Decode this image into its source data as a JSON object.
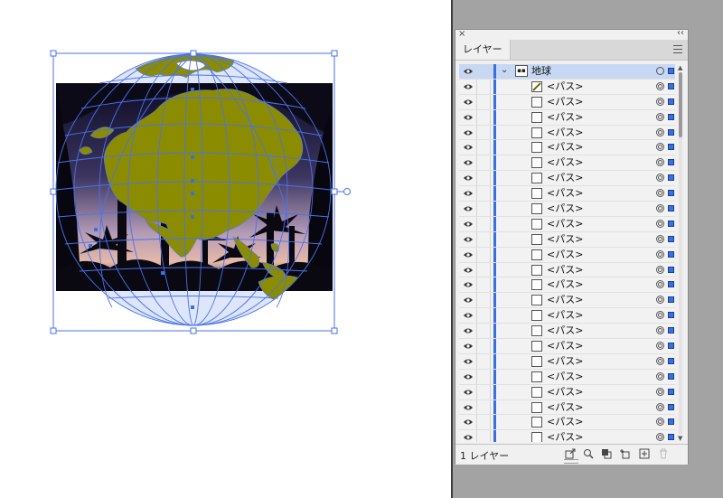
{
  "panel": {
    "close_glyph": "×",
    "collapse_glyph": "‹‹",
    "tab_label": "レイヤー",
    "menu_icon": "hamburger-menu-icon",
    "layer": {
      "name": "地球",
      "expanded": true,
      "selected": true
    },
    "sublayers": [
      {
        "name": "<パス>",
        "thumb": "diagonal"
      },
      {
        "name": "<パス>",
        "thumb": "blank"
      },
      {
        "name": "<パス>",
        "thumb": "blank"
      },
      {
        "name": "<パス>",
        "thumb": "blank"
      },
      {
        "name": "<パス>",
        "thumb": "blank"
      },
      {
        "name": "<パス>",
        "thumb": "blank"
      },
      {
        "name": "<パス>",
        "thumb": "blank"
      },
      {
        "name": "<パス>",
        "thumb": "blank"
      },
      {
        "name": "<パス>",
        "thumb": "blank"
      },
      {
        "name": "<パス>",
        "thumb": "blank"
      },
      {
        "name": "<パス>",
        "thumb": "blank"
      },
      {
        "name": "<パス>",
        "thumb": "blank"
      },
      {
        "name": "<パス>",
        "thumb": "blank"
      },
      {
        "name": "<パス>",
        "thumb": "blank"
      },
      {
        "name": "<パス>",
        "thumb": "blank"
      },
      {
        "name": "<パス>",
        "thumb": "blank"
      },
      {
        "name": "<パス>",
        "thumb": "blank"
      },
      {
        "name": "<パス>",
        "thumb": "blank"
      },
      {
        "name": "<パス>",
        "thumb": "blank"
      },
      {
        "name": "<パス>",
        "thumb": "blank"
      },
      {
        "name": "<パス>",
        "thumb": "blank"
      },
      {
        "name": "<パス>",
        "thumb": "blank"
      },
      {
        "name": "<パス>",
        "thumb": "blank"
      },
      {
        "name": "<パス>",
        "thumb": "blank"
      }
    ],
    "footer": {
      "layer_count": "1 レイヤー",
      "icons": [
        "export-icon",
        "search-icon",
        "clipping-mask-icon",
        "new-sublayer-icon",
        "new-layer-icon",
        "trash-icon"
      ]
    }
  },
  "colors": {
    "accent": "#3a6fe0",
    "selection_row": "#c6d8f3",
    "land": "#8c8c00",
    "globe_lines": "#4a72ee",
    "photo_dark": "#0d0d1e"
  }
}
